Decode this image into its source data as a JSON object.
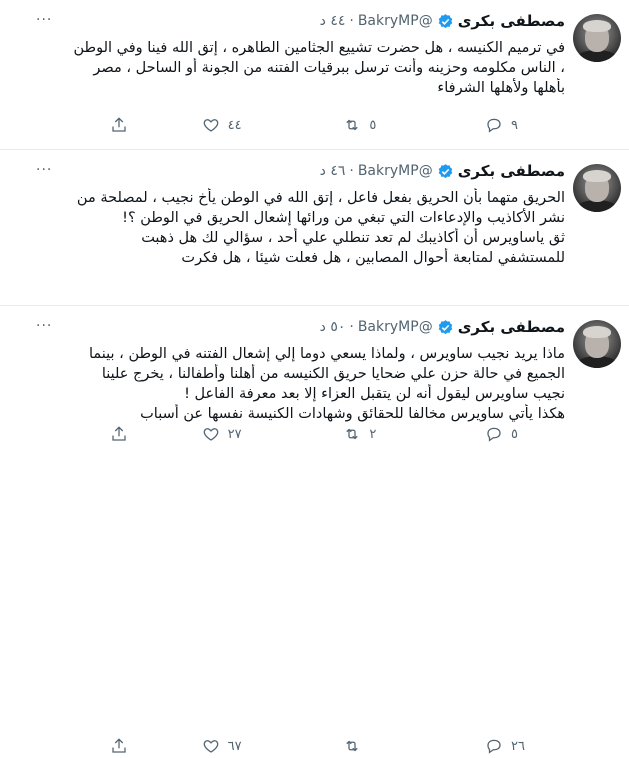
{
  "tweets": [
    {
      "name": "مصطفى بكرى",
      "handle": "@BakryMP",
      "sep": "·",
      "time": "٤٤ د",
      "lines": [
        "في ترميم الكنيسه ، هل حضرت تشييع الجثامين الطاهره ، إتق الله فينا وفي الوطن",
        "، الناس مكلومه وحزينه وأنت ترسل ببرقيات الفتنه من الجونة أو الساحل ، مصر",
        "بأهلها ولأهلها الشرفاء"
      ],
      "replies": "٩",
      "retweets": "٥",
      "likes": "٤٤"
    },
    {
      "name": "مصطفى بكرى",
      "handle": "@BakryMP",
      "sep": "·",
      "time": "٤٦ د",
      "lines": [
        "الحريق متهما بأن الحريق بفعل فاعل ، إتق الله في الوطن يأخ نجيب ، لمصلحة من",
        "نشر الأكاذيب والإدعاءات التي تبغي من ورائها إشعال الحريق في الوطن ؟!",
        "ثق ياساويرس أن أكاذيبك لم تعد تنطلي علي أحد ، سؤالي لك هل ذهبت",
        "للمستشفي لمتابعة أحوال المصابين ، هل فعلت شيئا ، هل فكرت"
      ],
      "replies": "٥",
      "retweets": "٢",
      "likes": "٢٧"
    },
    {
      "name": "مصطفى بكرى",
      "handle": "@BakryMP",
      "sep": "·",
      "time": "٥٠ د",
      "lines": [
        "ماذا يريد نجيب ساويرس ، ولماذا يسعي دوما إلي إشعال الفتنه في الوطن ، بينما",
        "الجميع في حالة حزن علي ضحايا حريق الكنيسه من أهلنا وأطفالنا ، يخرج علينا",
        "نجيب ساويرس ليقول أنه لن يتقبل العزاء إلا بعد معرفة الفاعل !",
        "هكذا يأتي ساويرس مخالفا للحقائق وشهادات الكنيسة نفسها عن أسباب"
      ],
      "replies": "٢٦",
      "retweets": "",
      "likes": "٦٧"
    }
  ]
}
